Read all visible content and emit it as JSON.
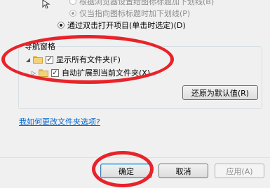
{
  "options": {
    "radio_browse_style": "根据浏览器设置给图标标题加下划线(B)",
    "radio_point_underline": "仅当指向图标标题时加下划线(P)",
    "radio_double_click": "通过双击打开项目(单击时选定)(D)"
  },
  "nav_pane": {
    "title": "导航窗格",
    "show_all_folders": "显示所有文件夹(F)",
    "auto_expand": "自动扩展到当前文件夹(X)"
  },
  "restore_defaults_label": "还原为默认值(R)",
  "help_link": "我如何更改文件夹选项?",
  "buttons": {
    "ok": "确定",
    "cancel": "取消",
    "apply": "应用(A)"
  },
  "checkmark": "✓",
  "expander_glyphs": {
    "expanded": "◢",
    "collapsed": "▷"
  },
  "annotation_color": "#e8232a"
}
